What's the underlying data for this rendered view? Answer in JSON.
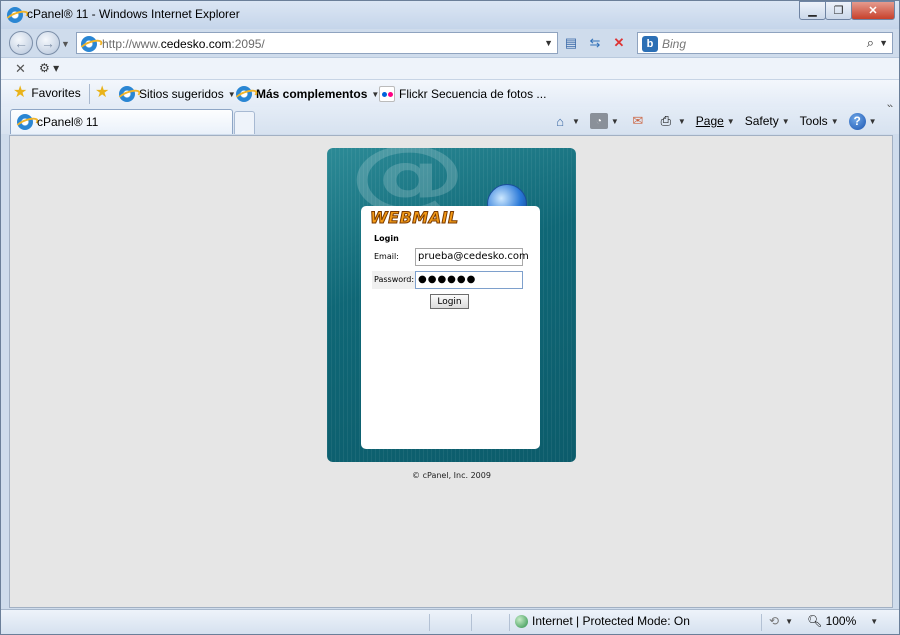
{
  "window": {
    "title": "cPanel® 11 - Windows Internet Explorer",
    "minimize": "▁",
    "restore": "❐",
    "close": "✕"
  },
  "address": {
    "url_prefix": "http://www.",
    "url_domain": "cedesko.com",
    "url_suffix": ":2095/"
  },
  "search": {
    "provider_icon": "b",
    "placeholder": "Bing"
  },
  "favorites_bar": {
    "favorites": "Favorites",
    "suggested": "Sitios sugeridos",
    "addons": "Más complementos",
    "flickr": "Flickr Secuencia de fotos ..."
  },
  "tab": {
    "label": "cPanel® 11"
  },
  "tools": {
    "page": "Page",
    "safety": "Safety",
    "tools": "Tools",
    "help": "?"
  },
  "webmail": {
    "brand": "WEBMAIL",
    "login_heading": "Login",
    "email_label": "Email:",
    "email_value": "prueba@cedesko.com",
    "password_label": "Password:",
    "password_value": "●●●●●●",
    "login_button": "Login",
    "copyright": "© cPanel, Inc. 2009",
    "watermark": "@"
  },
  "status": {
    "zone": "Internet | Protected Mode: On",
    "zoom": "100%"
  },
  "colors": {
    "card_teal": "#0f6776",
    "webmail_orange": "#f39a16",
    "content_bg": "#e6e6e6"
  }
}
